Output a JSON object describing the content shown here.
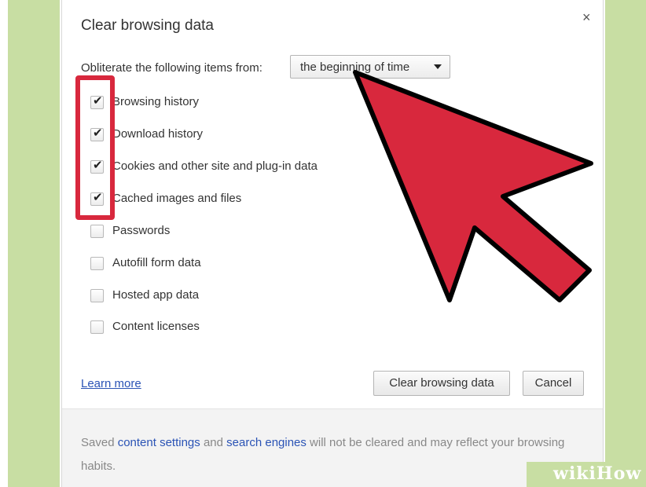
{
  "dialog": {
    "title": "Clear browsing data",
    "close_symbol": "×",
    "obliterate_label": "Obliterate the following items from:",
    "time_range": {
      "selected": "the beginning of time"
    },
    "options": [
      {
        "label": "Browsing history",
        "checked": true
      },
      {
        "label": "Download history",
        "checked": true
      },
      {
        "label": "Cookies and other site and plug-in data",
        "checked": true
      },
      {
        "label": "Cached images and files",
        "checked": true
      },
      {
        "label": "Passwords",
        "checked": false
      },
      {
        "label": "Autofill form data",
        "checked": false
      },
      {
        "label": "Hosted app data",
        "checked": false
      },
      {
        "label": "Content licenses",
        "checked": false
      }
    ],
    "learn_more": "Learn more",
    "clear_button": "Clear browsing data",
    "cancel_button": "Cancel",
    "footer": {
      "prefix": "Saved ",
      "link_content_settings": "content settings",
      "middle": " and ",
      "link_search_engines": "search engines",
      "suffix": " will not be cleared and may reflect your browsing habits."
    }
  },
  "overlay": {
    "arrow_icon": "red-pointer-arrow-icon",
    "highlight_color": "#d8283d",
    "watermark_wiki": "wiki",
    "watermark_how": "How"
  },
  "colors": {
    "background_green": "#c8dea3",
    "link_blue": "#2a53b5",
    "accent_red": "#d8283d"
  }
}
